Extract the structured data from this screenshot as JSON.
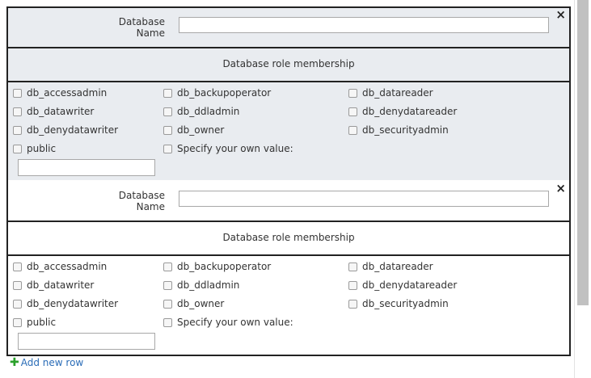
{
  "rows": [
    {
      "name_label": "Database Name",
      "name_value": "",
      "close": "×",
      "role_header": "Database role membership",
      "roles": [
        [
          "db_accessadmin",
          "db_backupoperator",
          "db_datareader"
        ],
        [
          "db_datawriter",
          "db_ddladmin",
          "db_denydatareader"
        ],
        [
          "db_denydatawriter",
          "db_owner",
          "db_securityadmin"
        ],
        [
          "public",
          "Specify your own value:",
          ""
        ]
      ],
      "custom_value": ""
    },
    {
      "name_label": "Database Name",
      "name_value": "",
      "close": "×",
      "role_header": "Database role membership",
      "roles": [
        [
          "db_accessadmin",
          "db_backupoperator",
          "db_datareader"
        ],
        [
          "db_datawriter",
          "db_ddladmin",
          "db_denydatareader"
        ],
        [
          "db_denydatawriter",
          "db_owner",
          "db_securityadmin"
        ],
        [
          "public",
          "Specify your own value:",
          ""
        ]
      ],
      "custom_value": ""
    }
  ],
  "add_row_label": "Add new row",
  "colors": {
    "plus": "#2aa02a",
    "link": "#2a6cb7",
    "gray_bg": "#e9ecf0"
  }
}
